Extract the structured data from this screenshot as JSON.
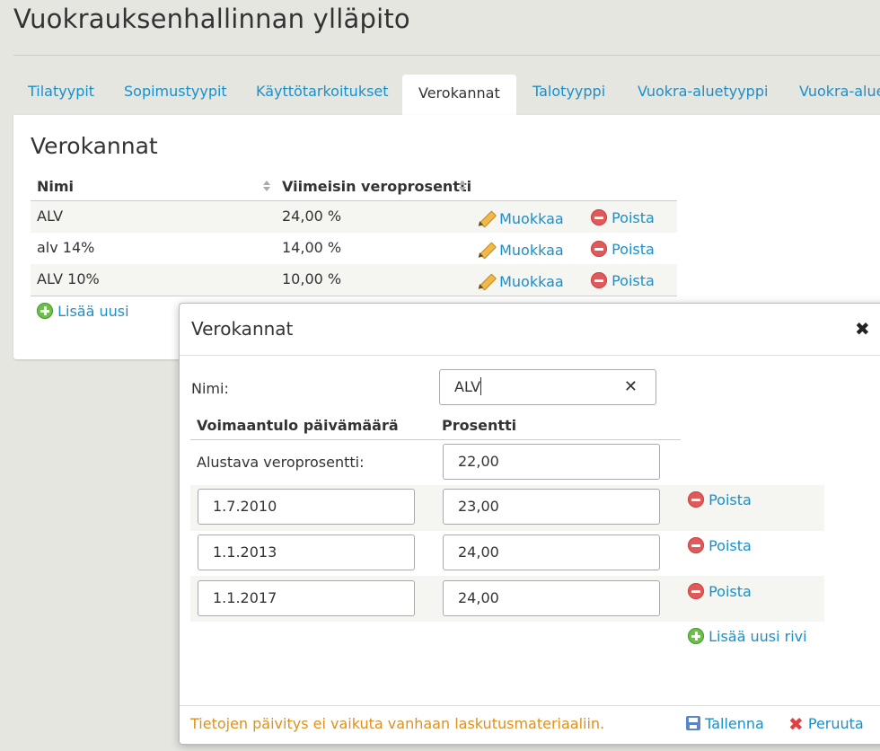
{
  "page": {
    "title": "Vuokrauksenhallinnan ylläpito"
  },
  "tabs": [
    {
      "label": "Tilatyypit"
    },
    {
      "label": "Sopimustyypit"
    },
    {
      "label": "Käyttötarkoitukset"
    },
    {
      "label": "Verokannat",
      "active": true
    },
    {
      "label": "Talotyyppi"
    },
    {
      "label": "Vuokra-aluetyyppi"
    },
    {
      "label": "Vuokra-alue"
    }
  ],
  "panel": {
    "title": "Verokannat",
    "columns": [
      "Nimi",
      "Viimeisin veroprosentti"
    ],
    "rows": [
      {
        "name": "ALV",
        "rate": "24,00 %"
      },
      {
        "name": "alv 14%",
        "rate": "14,00 %"
      },
      {
        "name": "ALV 10%",
        "rate": "10,00 %"
      }
    ],
    "edit_label": "Muokkaa",
    "delete_label": "Poista",
    "add_label": "Lisää uusi"
  },
  "dialog": {
    "title": "Verokannat",
    "close_glyph": "✖",
    "name_label": "Nimi:",
    "name_value": "ALV",
    "clear_glyph": "✕",
    "col_date": "Voimaantulo päivämäärä",
    "col_percent": "Prosentti",
    "initial_label": "Alustava veroprosentti:",
    "initial_value": "22,00",
    "rows": [
      {
        "date": "1.7.2010",
        "percent": "23,00"
      },
      {
        "date": "1.1.2013",
        "percent": "24,00"
      },
      {
        "date": "1.1.2017",
        "percent": "24,00"
      }
    ],
    "delete_label": "Poista",
    "add_row_label": "Lisää uusi rivi",
    "warning": "Tietojen päivitys ei vaikuta vanhaan laskutusmateriaaliin.",
    "save_label": "Tallenna",
    "cancel_label": "Peruuta"
  },
  "colors": {
    "link": "#1a8fc9",
    "warning": "#e0901a",
    "delete": "#e05a5a",
    "add": "#6cbf4a"
  }
}
